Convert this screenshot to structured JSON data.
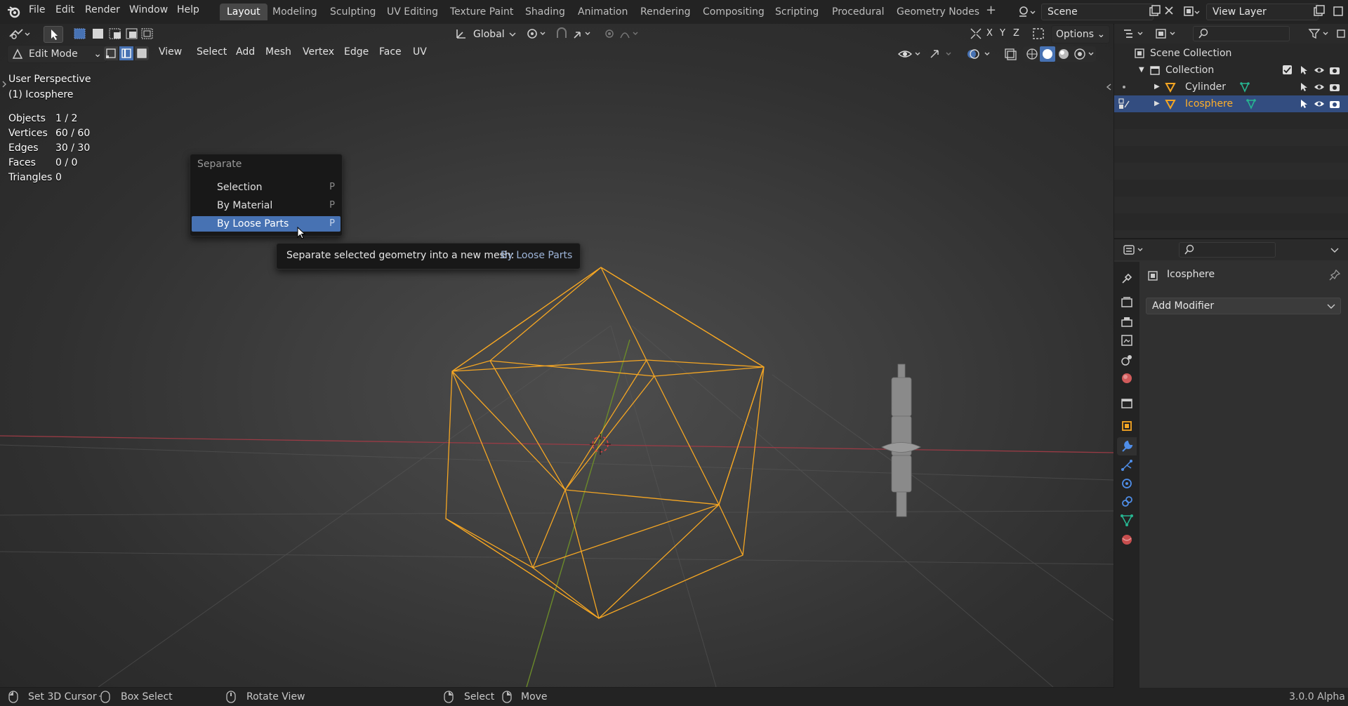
{
  "menubar": {
    "items": [
      "File",
      "Edit",
      "Render",
      "Window",
      "Help"
    ],
    "workspaces": [
      "Layout",
      "Modeling",
      "Sculpting",
      "UV Editing",
      "Texture Paint",
      "Shading",
      "Animation",
      "Rendering",
      "Compositing",
      "Scripting",
      "Procedural",
      "Geometry Nodes"
    ],
    "active_workspace": "Layout",
    "add_tab": "+",
    "scene": "Scene",
    "view_layer": "View Layer"
  },
  "tool_header": {
    "transform_orientation": "Global",
    "axes": [
      "X",
      "Y",
      "Z"
    ],
    "options": "Options"
  },
  "viewport_header": {
    "mode": "Edit Mode",
    "menus": [
      "View",
      "Select",
      "Add",
      "Mesh",
      "Vertex",
      "Edge",
      "Face",
      "UV"
    ]
  },
  "overlay_info": {
    "perspective": "User Perspective",
    "object": "(1) Icosphere",
    "stats": [
      {
        "label": "Objects",
        "value": "1 / 2"
      },
      {
        "label": "Vertices",
        "value": "60 / 60"
      },
      {
        "label": "Edges",
        "value": "30 / 30"
      },
      {
        "label": "Faces",
        "value": "0 / 0"
      },
      {
        "label": "Triangles",
        "value": "0"
      }
    ]
  },
  "separate_menu": {
    "title": "Separate",
    "items": [
      {
        "label": "Selection",
        "shortcut": "P"
      },
      {
        "label": "By Material",
        "shortcut": "P"
      },
      {
        "label": "By Loose Parts",
        "shortcut": "P"
      }
    ],
    "highlighted": "By Loose Parts"
  },
  "tooltip": {
    "text": "Separate selected geometry into a new mesh:",
    "operator": "By Loose Parts"
  },
  "outliner": {
    "scene_collection": "Scene Collection",
    "collection": "Collection",
    "objects": [
      {
        "name": "Cylinder",
        "selected": false
      },
      {
        "name": "Icosphere",
        "selected": true
      }
    ]
  },
  "properties": {
    "object_name": "Icosphere",
    "add_modifier": "Add Modifier"
  },
  "statusbar": {
    "items": [
      "Set 3D Cursor",
      "Box Select",
      "Rotate View",
      "Select",
      "Move"
    ],
    "version": "3.0.0 Alpha"
  },
  "colors": {
    "accent": "#4772b3",
    "wire": "#f5a623",
    "outliner_selected": "#334d80"
  }
}
